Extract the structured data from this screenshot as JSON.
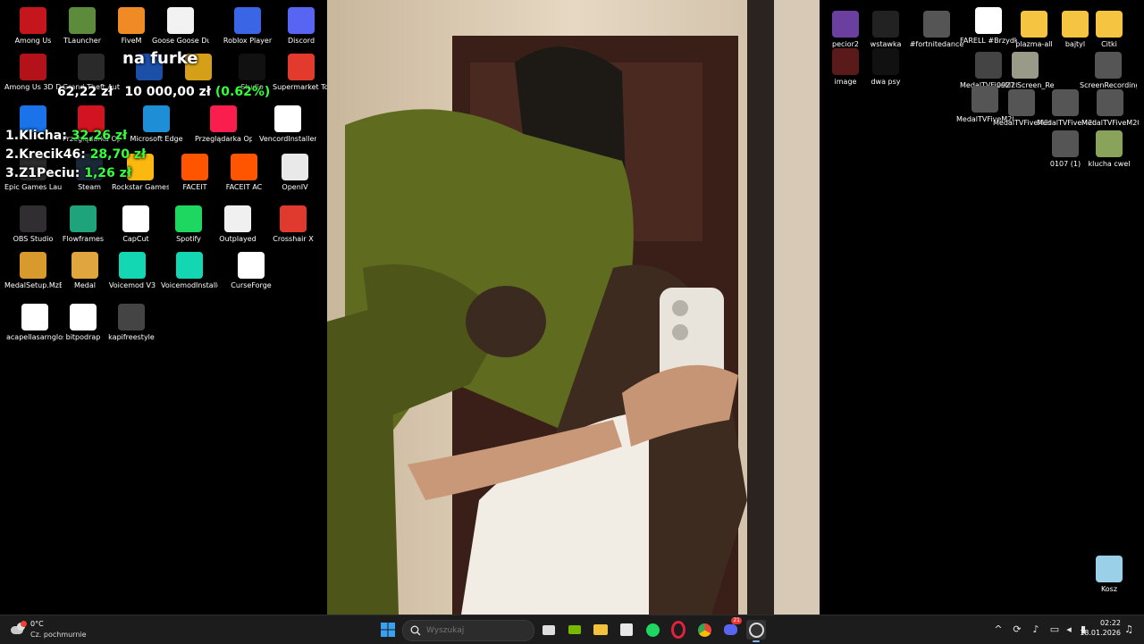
{
  "desktop": {
    "left_icons": [
      {
        "name": "among-us-icon",
        "label": "Among Us",
        "color": "#c5161d"
      },
      {
        "name": "tlauncher-icon",
        "label": "TLauncher",
        "color": "#5c8c3b"
      },
      {
        "name": "fivem-icon",
        "label": "FiveM",
        "color": "#f08a24"
      },
      {
        "name": "goose-goose-duck-icon",
        "label": "Goose Goose Duck",
        "color": "#f2f2f2"
      },
      {
        "name": "roblox-player-icon",
        "label": "Roblox Player",
        "color": "#3a66e6"
      },
      {
        "name": "discord-icon",
        "label": "Discord",
        "color": "#5865f2"
      },
      {
        "name": "among-us-3d-icon",
        "label": "Among Us 3D Demo",
        "color": "#b3121b"
      },
      {
        "name": "gta-v-icon",
        "label": "Grand Theft Auto V",
        "color": "#2a2a2a"
      },
      {
        "name": "rocket-league-icon",
        "label": "",
        "color": "#1b4fa8"
      },
      {
        "name": "payday-icon",
        "label": "",
        "color": "#d4a017"
      },
      {
        "name": "roblox-studio-icon",
        "label": "Studio",
        "color": "#111111"
      },
      {
        "name": "supermarket-together-icon",
        "label": "Supermarket Together",
        "color": "#e23b2e"
      },
      {
        "name": "chrome-icon",
        "label": "",
        "color": "#1a73e8"
      },
      {
        "name": "opera-icon",
        "label": "Przeglądarka Opera",
        "color": "#d1141f"
      },
      {
        "name": "edge-icon",
        "label": "Microsoft Edge",
        "color": "#1e8fd6"
      },
      {
        "name": "opera-gx-icon",
        "label": "Przeglądarka Opera GX",
        "color": "#fa1e4e"
      },
      {
        "name": "vencord-installer-icon",
        "label": "VencordInstaller",
        "color": "#ffffff"
      },
      {
        "name": "epic-games-icon",
        "label": "Epic Games Launcher",
        "color": "#2a2a2a"
      },
      {
        "name": "steam-icon",
        "label": "Steam",
        "color": "#1b2838"
      },
      {
        "name": "rockstar-icon",
        "label": "Rockstar Games Launcher",
        "color": "#fbb80f"
      },
      {
        "name": "faceit-icon",
        "label": "FACEIT",
        "color": "#ff5500"
      },
      {
        "name": "faceit-ac-icon",
        "label": "FACEIT AC",
        "color": "#ff5500"
      },
      {
        "name": "openiv-icon",
        "label": "OpenIV",
        "color": "#e9e9e9"
      },
      {
        "name": "obs-studio-icon",
        "label": "OBS Studio",
        "color": "#302e31"
      },
      {
        "name": "flowframes-icon",
        "label": "Flowframes",
        "color": "#1fa37a"
      },
      {
        "name": "capcut-icon",
        "label": "CapCut",
        "color": "#ffffff"
      },
      {
        "name": "spotify-icon",
        "label": "Spotify",
        "color": "#1ed760"
      },
      {
        "name": "outplayed-icon",
        "label": "Outplayed",
        "color": "#f0f0f0"
      },
      {
        "name": "crosshair-x-icon",
        "label": "Crosshair X",
        "color": "#e03a2f"
      },
      {
        "name": "medal-setup-icon",
        "label": "MedalSetup.MzE4...",
        "color": "#d89a2c"
      },
      {
        "name": "medal-icon",
        "label": "Medal",
        "color": "#e0a53c"
      },
      {
        "name": "voicemod-v3-icon",
        "label": "Voicemod V3",
        "color": "#13d6b3"
      },
      {
        "name": "voicemod-installer-icon",
        "label": "VoicemodInstaller_...",
        "color": "#13d6b3"
      },
      {
        "name": "curseforge-icon",
        "label": "CurseForge",
        "color": "#ffffff"
      },
      {
        "name": "acapellasarnglos-icon",
        "label": "acapellasarnglos",
        "color": "#ffffff"
      },
      {
        "name": "bitpodrap-icon",
        "label": "bitpodrap",
        "color": "#ffffff"
      },
      {
        "name": "kapifreestyle-icon",
        "label": "kapifreestyle",
        "color": "#444444"
      }
    ],
    "right_icons": [
      {
        "name": "pecior2-icon",
        "label": "pecior2",
        "color": "#6a3fa0"
      },
      {
        "name": "wstawka-icon",
        "label": "wstawka",
        "color": "#222222"
      },
      {
        "name": "fortnitedance-icon",
        "label": "#fortnitedance",
        "color": "#555555"
      },
      {
        "name": "farell-icon",
        "label": "FARELL #Brzydka16Challe...",
        "color": "#ffffff"
      },
      {
        "name": "plazma-all-icon",
        "label": "plazma-all",
        "color": "#f5c542"
      },
      {
        "name": "bajtyl-icon",
        "label": "bajtyl",
        "color": "#f5c542"
      },
      {
        "name": "citki-icon",
        "label": "Citki",
        "color": "#f5c542"
      },
      {
        "name": "image-icon",
        "label": "image",
        "color": "#5a1a1a"
      },
      {
        "name": "dwa-psy-icon",
        "label": "dwa psy",
        "color": "#111111"
      },
      {
        "name": "medaltv-fivem-1-icon",
        "label": "MedalTVFiveM202...",
        "color": "#444444"
      },
      {
        "name": "screen-recording-1-icon",
        "label": "0927 Screen_Recording...",
        "color": "#9a9a88"
      },
      {
        "name": "screen-recording-2-icon",
        "label": "ScreenRecording_...",
        "color": "#555555"
      },
      {
        "name": "medaltv-fivem-2-icon",
        "label": "MedalTVFiveM202...",
        "color": "#555555"
      },
      {
        "name": "medaltv-fivem-3-icon",
        "label": "MedalTVFiveM202...",
        "color": "#555555"
      },
      {
        "name": "medaltv-fivem-4-icon",
        "label": "MedalTVFiveM202...",
        "color": "#555555"
      },
      {
        "name": "medaltv-fivem-5-icon",
        "label": "MedalTVFiveM202...",
        "color": "#555555"
      },
      {
        "name": "clip-0107-icon",
        "label": "0107 (1)",
        "color": "#555555"
      },
      {
        "name": "klucha-cwel-icon",
        "label": "klucha cwel",
        "color": "#8aa35a"
      },
      {
        "name": "recycle-bin-icon",
        "label": "Kosz",
        "color": "#9ad0e8"
      }
    ]
  },
  "overlay": {
    "title": "na furke",
    "amount": "62,22 zł",
    "goal": "10 000,00 zł",
    "percent": "(0.62%)",
    "leaderboard": [
      {
        "rank": "1.",
        "name": "Klicha:",
        "value": "32,26 zł"
      },
      {
        "rank": "2.",
        "name": "Krecik46:",
        "value": "28,70 zł"
      },
      {
        "rank": "3.",
        "name": "Z1Peciu:",
        "value": "1,26 zł"
      }
    ]
  },
  "taskbar": {
    "weather_temp": "0°C",
    "weather_desc": "Cz. pochmurnie",
    "search_placeholder": "Wyszukaj",
    "time": "02:22",
    "date": "18.01.2026",
    "discord_badge": "21"
  }
}
